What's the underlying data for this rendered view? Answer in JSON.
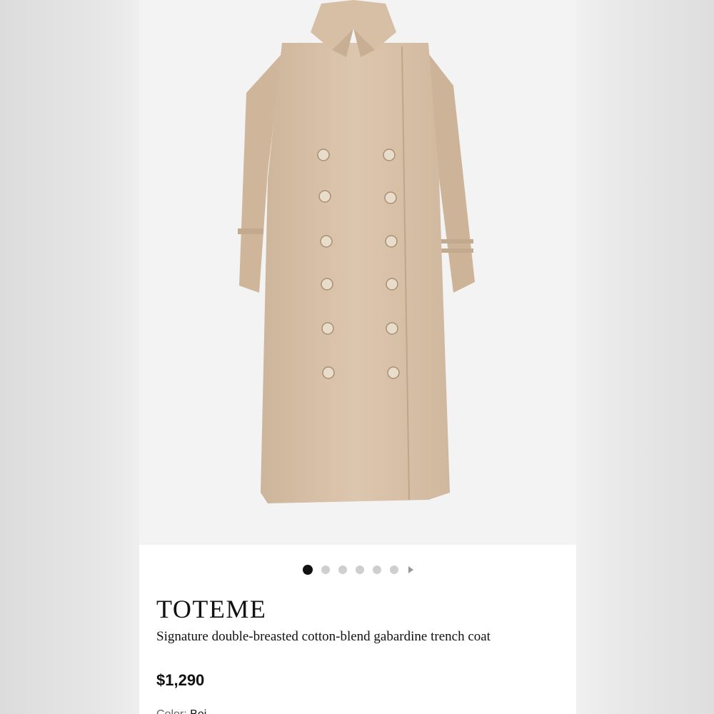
{
  "product": {
    "brand": "TOTEME",
    "title": "Signature double-breasted cotton-blend gabardine trench coat",
    "price": "$1,290",
    "color_label": "Color:",
    "color_value": "Bei"
  },
  "gallery": {
    "total_images": 6,
    "active_index": 0,
    "has_next_arrow": true
  },
  "colors": {
    "coat": "#d8c1a8",
    "background": "#f3f3f3",
    "active_dot": "#111111",
    "inactive_dot": "#cfcfcf"
  }
}
